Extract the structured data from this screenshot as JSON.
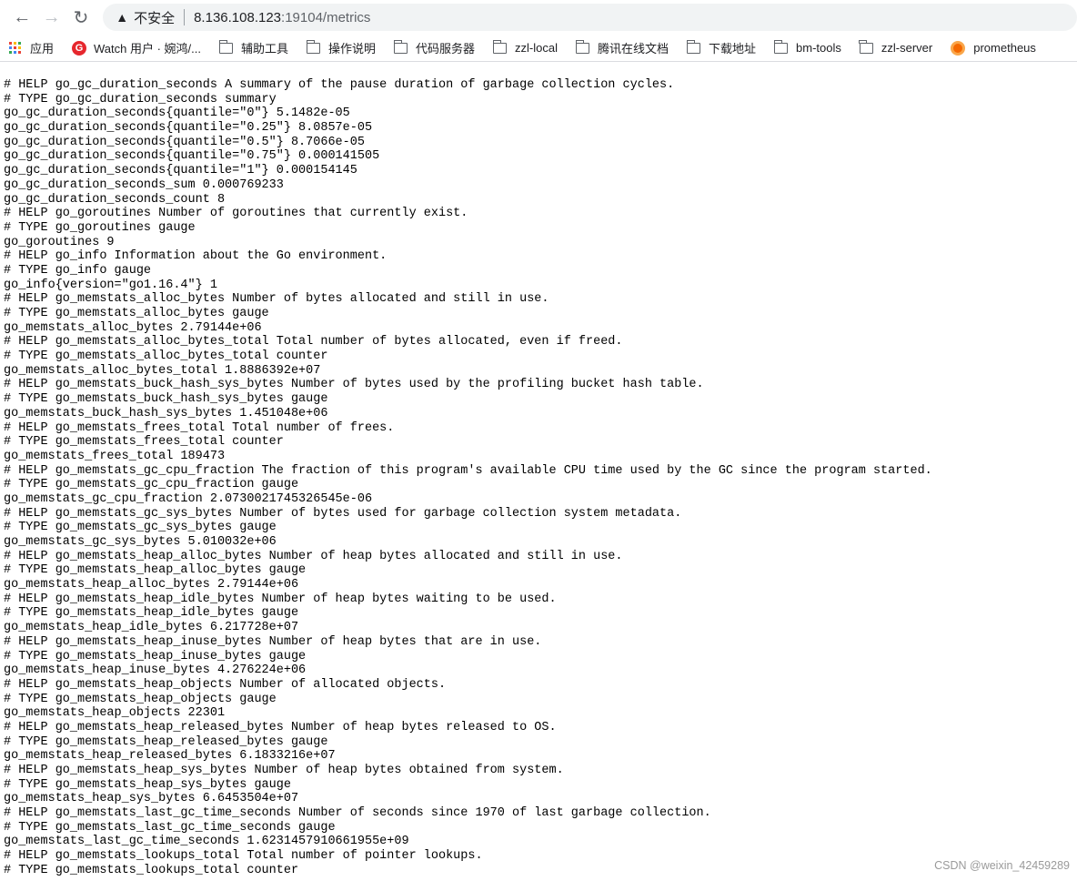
{
  "browser": {
    "url_host": "8.136.108.123",
    "url_path": ":19104/metrics",
    "security_label": "不安全"
  },
  "bookmarks": [
    {
      "label": "应用",
      "icon": "apps-grid-icon"
    },
    {
      "label": "Watch 用户 · 婉鸿/...",
      "icon": "gitee-icon"
    },
    {
      "label": "辅助工具",
      "icon": "folder-icon"
    },
    {
      "label": "操作说明",
      "icon": "folder-icon"
    },
    {
      "label": "代码服务器",
      "icon": "folder-icon"
    },
    {
      "label": "zzl-local",
      "icon": "folder-icon"
    },
    {
      "label": "腾讯在线文档",
      "icon": "folder-icon"
    },
    {
      "label": "下载地址",
      "icon": "folder-icon"
    },
    {
      "label": "bm-tools",
      "icon": "folder-icon"
    },
    {
      "label": "zzl-server",
      "icon": "folder-icon"
    },
    {
      "label": "prometheus",
      "icon": "grafana-icon"
    }
  ],
  "lines": [
    "# HELP go_gc_duration_seconds A summary of the pause duration of garbage collection cycles.",
    "# TYPE go_gc_duration_seconds summary",
    "go_gc_duration_seconds{quantile=\"0\"} 5.1482e-05",
    "go_gc_duration_seconds{quantile=\"0.25\"} 8.0857e-05",
    "go_gc_duration_seconds{quantile=\"0.5\"} 8.7066e-05",
    "go_gc_duration_seconds{quantile=\"0.75\"} 0.000141505",
    "go_gc_duration_seconds{quantile=\"1\"} 0.000154145",
    "go_gc_duration_seconds_sum 0.000769233",
    "go_gc_duration_seconds_count 8",
    "# HELP go_goroutines Number of goroutines that currently exist.",
    "# TYPE go_goroutines gauge",
    "go_goroutines 9",
    "# HELP go_info Information about the Go environment.",
    "# TYPE go_info gauge",
    "go_info{version=\"go1.16.4\"} 1",
    "# HELP go_memstats_alloc_bytes Number of bytes allocated and still in use.",
    "# TYPE go_memstats_alloc_bytes gauge",
    "go_memstats_alloc_bytes 2.79144e+06",
    "# HELP go_memstats_alloc_bytes_total Total number of bytes allocated, even if freed.",
    "# TYPE go_memstats_alloc_bytes_total counter",
    "go_memstats_alloc_bytes_total 1.8886392e+07",
    "# HELP go_memstats_buck_hash_sys_bytes Number of bytes used by the profiling bucket hash table.",
    "# TYPE go_memstats_buck_hash_sys_bytes gauge",
    "go_memstats_buck_hash_sys_bytes 1.451048e+06",
    "# HELP go_memstats_frees_total Total number of frees.",
    "# TYPE go_memstats_frees_total counter",
    "go_memstats_frees_total 189473",
    "# HELP go_memstats_gc_cpu_fraction The fraction of this program's available CPU time used by the GC since the program started.",
    "# TYPE go_memstats_gc_cpu_fraction gauge",
    "go_memstats_gc_cpu_fraction 2.0730021745326545e-06",
    "# HELP go_memstats_gc_sys_bytes Number of bytes used for garbage collection system metadata.",
    "# TYPE go_memstats_gc_sys_bytes gauge",
    "go_memstats_gc_sys_bytes 5.010032e+06",
    "# HELP go_memstats_heap_alloc_bytes Number of heap bytes allocated and still in use.",
    "# TYPE go_memstats_heap_alloc_bytes gauge",
    "go_memstats_heap_alloc_bytes 2.79144e+06",
    "# HELP go_memstats_heap_idle_bytes Number of heap bytes waiting to be used.",
    "# TYPE go_memstats_heap_idle_bytes gauge",
    "go_memstats_heap_idle_bytes 6.217728e+07",
    "# HELP go_memstats_heap_inuse_bytes Number of heap bytes that are in use.",
    "# TYPE go_memstats_heap_inuse_bytes gauge",
    "go_memstats_heap_inuse_bytes 4.276224e+06",
    "# HELP go_memstats_heap_objects Number of allocated objects.",
    "# TYPE go_memstats_heap_objects gauge",
    "go_memstats_heap_objects 22301",
    "# HELP go_memstats_heap_released_bytes Number of heap bytes released to OS.",
    "# TYPE go_memstats_heap_released_bytes gauge",
    "go_memstats_heap_released_bytes 6.1833216e+07",
    "# HELP go_memstats_heap_sys_bytes Number of heap bytes obtained from system.",
    "# TYPE go_memstats_heap_sys_bytes gauge",
    "go_memstats_heap_sys_bytes 6.6453504e+07",
    "# HELP go_memstats_last_gc_time_seconds Number of seconds since 1970 of last garbage collection.",
    "# TYPE go_memstats_last_gc_time_seconds gauge",
    "go_memstats_last_gc_time_seconds 1.6231457910661955e+09",
    "# HELP go_memstats_lookups_total Total number of pointer lookups.",
    "# TYPE go_memstats_lookups_total counter"
  ],
  "watermark": "CSDN @weixin_42459289"
}
